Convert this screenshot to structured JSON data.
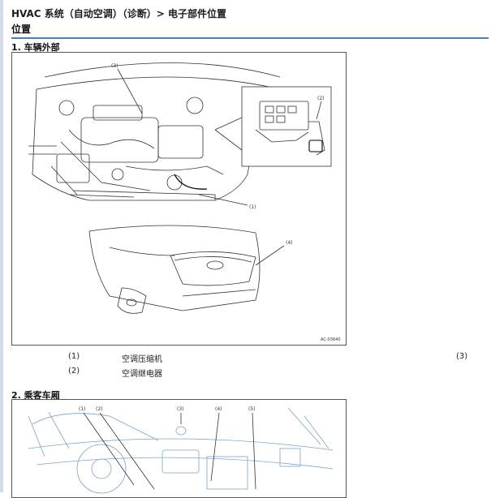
{
  "breadcrumb": "HVAC 系统（自动空调）（诊断）> 电子部件位置",
  "section_title": "位置",
  "part1": {
    "heading": "1.  车辆外部",
    "figure_code": "AC-03640",
    "callouts": [
      "(1)",
      "(2)",
      "(3)",
      "(4)"
    ],
    "legend": [
      {
        "num": "(1)",
        "name": "空调压缩机"
      },
      {
        "num": "(2)",
        "name": "空调继电器"
      }
    ],
    "legend_right_num": "(3)"
  },
  "part2": {
    "heading": "2.  乘客车厢",
    "callouts": [
      "(1)",
      "(2)",
      "(3)",
      "(4)",
      "(5)"
    ]
  }
}
